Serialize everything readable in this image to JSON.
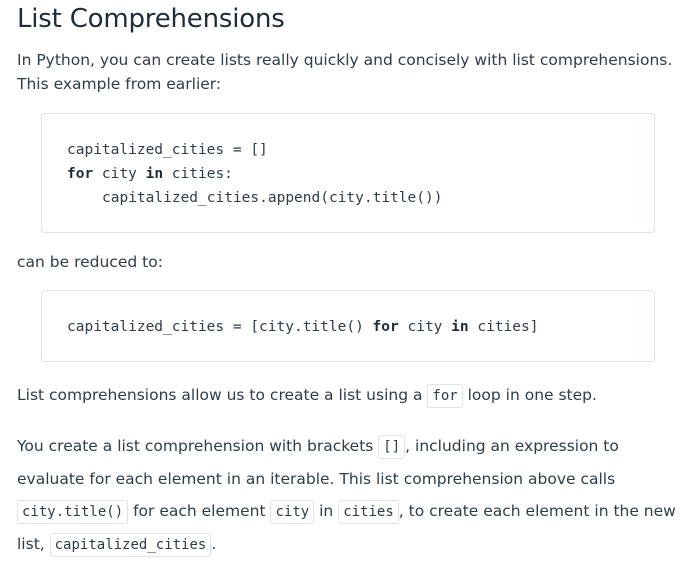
{
  "heading": "List Comprehensions",
  "intro": {
    "text": "In Python, you can create lists really quickly and concisely with list comprehensions. This example from earlier:"
  },
  "code1": {
    "line1": "capitalized_cities = []",
    "line2_kw1": "for",
    "line2_mid": " city ",
    "line2_kw2": "in",
    "line2_end": " cities:",
    "line3": "capitalized_cities.append(city.title())"
  },
  "reduced": {
    "text": "can be reduced to:"
  },
  "code2": {
    "part1": "capitalized_cities = [city.title() ",
    "kw1": "for",
    "part2": " city ",
    "kw2": "in",
    "part3": " cities]"
  },
  "para3": {
    "before": "List comprehensions allow us to create a list using a ",
    "code": "for",
    "after": " loop in one step."
  },
  "para4": {
    "t1": "You create a list comprehension with brackets ",
    "c1": "[]",
    "t2": ", including an expression to evaluate for each element in an iterable. This list comprehension above calls ",
    "c2": "city.title()",
    "t3": " for each element ",
    "c3": "city",
    "t4": " in ",
    "c4": "cities",
    "t5": ", to create each element in the new list, ",
    "c5": "capitalized_cities",
    "t6": "."
  }
}
